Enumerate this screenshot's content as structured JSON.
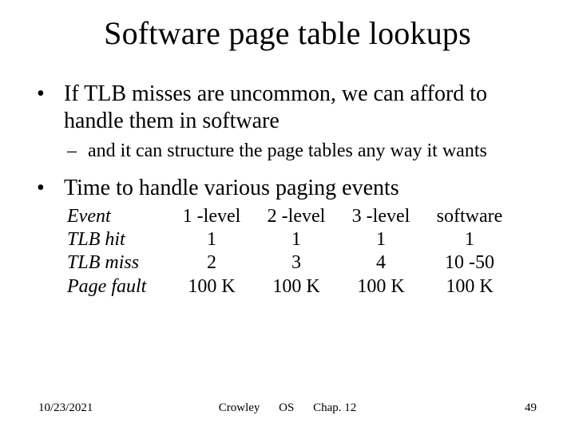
{
  "title": "Software page table lookups",
  "bullets": {
    "b1": "If TLB misses are uncommon, we can afford to handle them in software",
    "s1": "and it can structure the page tables any way it wants",
    "b2": "Time to handle various paging events"
  },
  "chart_data": {
    "type": "table",
    "headers": {
      "event": "Event",
      "c1": "1 -level",
      "c2": "2 -level",
      "c3": "3 -level",
      "c4": "software"
    },
    "rows": [
      {
        "event": "TLB hit",
        "c1": "1",
        "c2": "1",
        "c3": "1",
        "c4": "1"
      },
      {
        "event": "TLB miss",
        "c1": "2",
        "c2": "3",
        "c3": "4",
        "c4": "10 -50"
      },
      {
        "event": "Page fault",
        "c1": "100 K",
        "c2": "100 K",
        "c3": "100 K",
        "c4": "100 K"
      }
    ]
  },
  "footer": {
    "date": "10/23/2021",
    "author": "Crowley",
    "course": "OS",
    "chapter": "Chap. 12",
    "page": "49"
  }
}
